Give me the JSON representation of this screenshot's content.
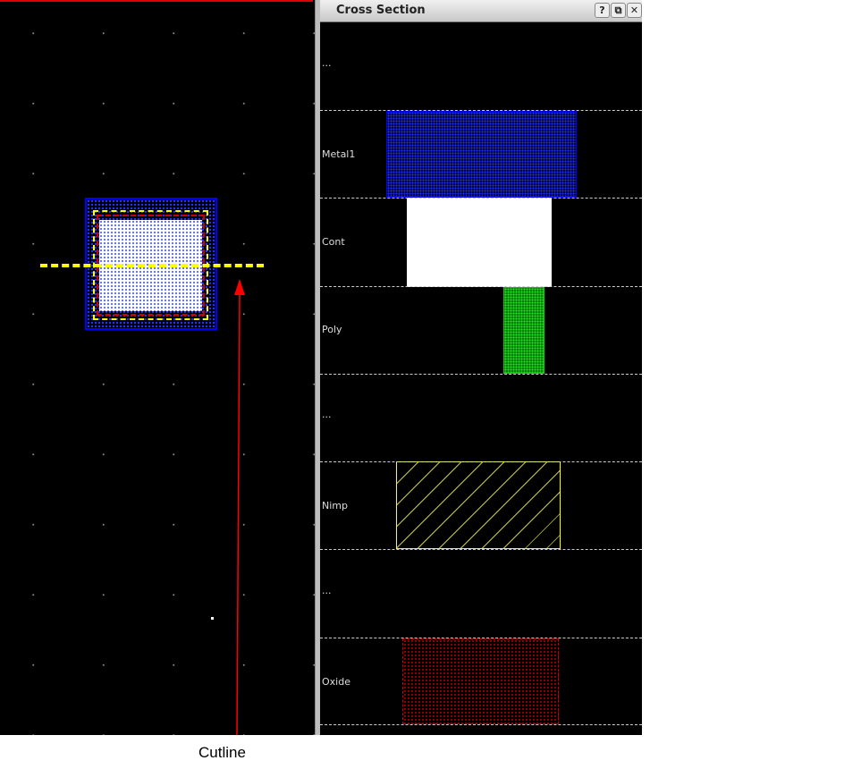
{
  "panel": {
    "title": "Cross Section",
    "buttons": [
      "?",
      "⧉",
      "✕"
    ]
  },
  "rows": [
    {
      "label": "..."
    },
    {
      "label": "Metal1"
    },
    {
      "label": "Cont"
    },
    {
      "label": "Poly"
    },
    {
      "label": "..."
    },
    {
      "label": "Nimp"
    },
    {
      "label": "..."
    },
    {
      "label": "Oxide"
    }
  ],
  "annotation": {
    "cutline_label": "Cutline"
  },
  "colors": {
    "metal1": "#0000ff",
    "cont": "#ffffff",
    "poly": "#00cc00",
    "nimp": "#ffff00",
    "oxide": "#cc0000",
    "cutline": "#ffff00",
    "arrow": "#ff0000"
  }
}
